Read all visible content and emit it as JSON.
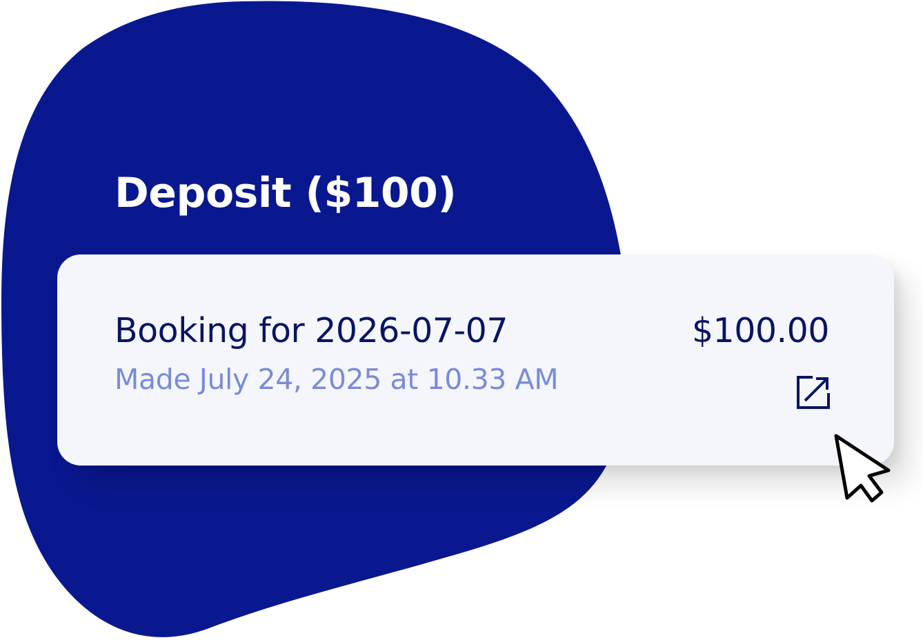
{
  "colors": {
    "blob": "#0a1890",
    "card_background": "#f4f6fc",
    "primary_text": "#0a1463",
    "secondary_text": "#7b8bd8",
    "title_text": "#ffffff"
  },
  "section": {
    "title": "Deposit ($100)"
  },
  "booking": {
    "title": "Booking for 2026-07-07",
    "made": "Made July 24, 2025 at 10.33 AM",
    "amount": "$100.00",
    "open_icon": "external-link-icon"
  },
  "cursor": {
    "icon": "mouse-pointer-icon"
  }
}
